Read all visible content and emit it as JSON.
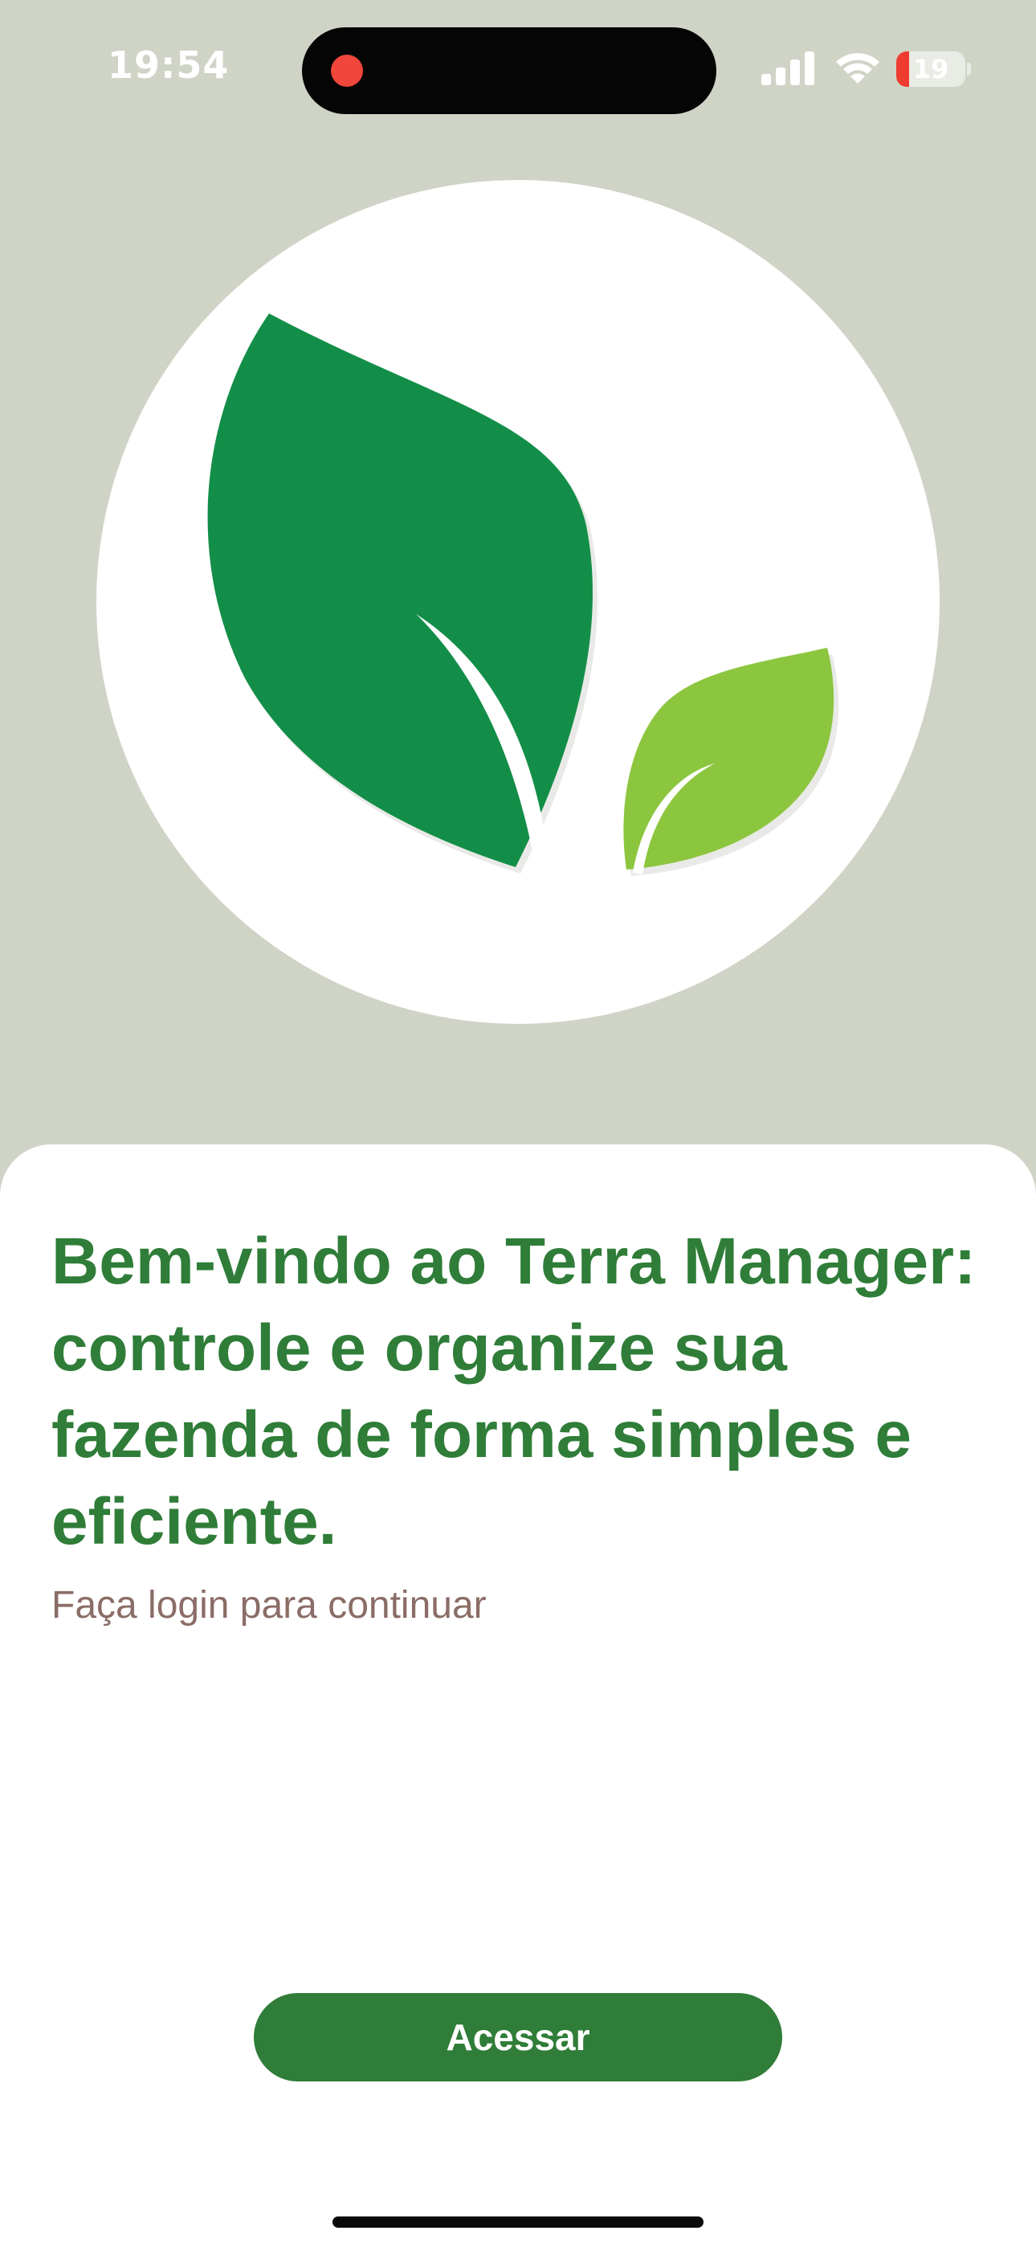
{
  "status_bar": {
    "time": "19:54",
    "battery_level": "19",
    "battery_fraction": 0.19,
    "colors": {
      "recording_dot": "#f0463c",
      "battery_low": "#ef3b30"
    },
    "icons": [
      "recording-dot-icon",
      "cellular-signal-icon",
      "wifi-icon",
      "battery-icon"
    ]
  },
  "logo": {
    "icon": "leaves-logo-icon",
    "colors": {
      "dark_leaf": "#138e48",
      "light_leaf": "#8cc63f",
      "circle": "#ffffff"
    }
  },
  "welcome": {
    "title": "Bem-vindo ao Terra Manager: controle e organize sua fazenda de forma simples e eficiente.",
    "subtitle": "Faça login para continuar"
  },
  "actions": {
    "access_label": "Acessar"
  },
  "theme": {
    "background": "#cfd4c6",
    "primary": "#2f7d38",
    "subtitle_color": "#8a6d66"
  }
}
